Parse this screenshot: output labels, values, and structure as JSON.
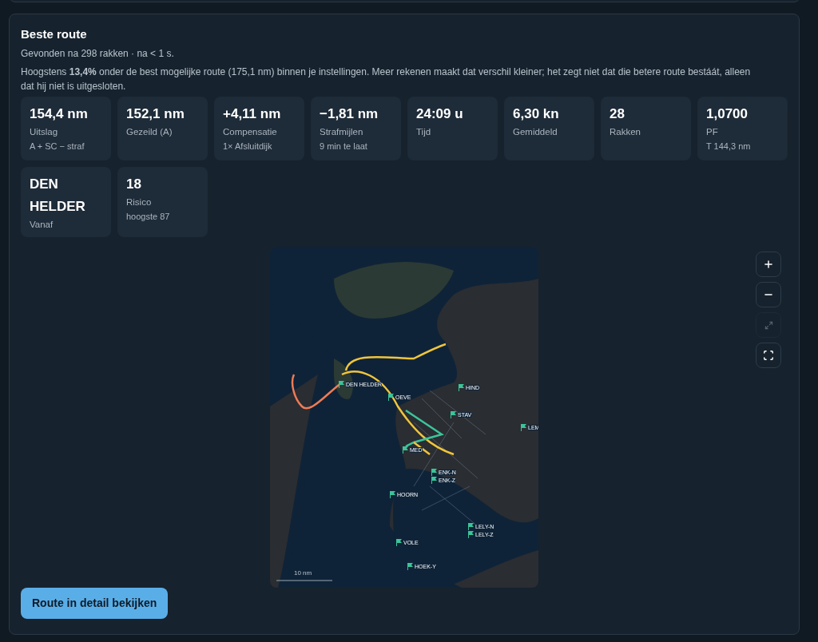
{
  "title": "Beste route",
  "subtitle": "Gevonden na 298 rakken · na < 1 s.",
  "note": "Hoogstens **13,4%** onder de best mogelijke route (175,1 nm) binnen je instellingen. Meer rekenen maakt dat verschil kleiner; het zegt niet dat die betere route bestáát, alleen dat hij niet is uitgesloten.",
  "stats": [
    {
      "value": "154,4 nm",
      "label": "Uitslag",
      "detail": "A + SC − straf"
    },
    {
      "value": "152,1 nm",
      "label": "Gezeild (A)"
    },
    {
      "value": "+4,11 nm",
      "label": "Compensatie",
      "detail": "1× Afsluitdijk"
    },
    {
      "value": "−1,81 nm",
      "label": "Strafmijlen",
      "detail": "9 min te laat"
    },
    {
      "value": "24:09 u",
      "label": "Tijd"
    },
    {
      "value": "6,30 kn",
      "label": "Gemiddeld"
    },
    {
      "value": "28",
      "label": "Rakken"
    },
    {
      "value": "1,0700",
      "label": "PF",
      "detail": "T 144,3 nm"
    },
    {
      "value": "DEN HELDER",
      "label": "Vanaf"
    },
    {
      "value": "18",
      "label": "Risico",
      "detail": "hoogste 87"
    }
  ],
  "map": {
    "labels": [
      "DEN HELDER",
      "OEVE",
      "HIND",
      "STAV",
      "LEM",
      "MED",
      "ENK-N",
      "ENK-Z",
      "HOORN",
      "LELY-N",
      "LELY-Z",
      "VOLE",
      "HOEK-Y"
    ],
    "scale": "10 nm"
  },
  "map_controls": [
    {
      "kind": "zoom-in",
      "disabled": false
    },
    {
      "kind": "zoom-out",
      "disabled": false
    },
    {
      "kind": "reset",
      "disabled": true
    },
    {
      "kind": "fullscreen",
      "disabled": false
    }
  ],
  "button": "Route in detail bekijken"
}
